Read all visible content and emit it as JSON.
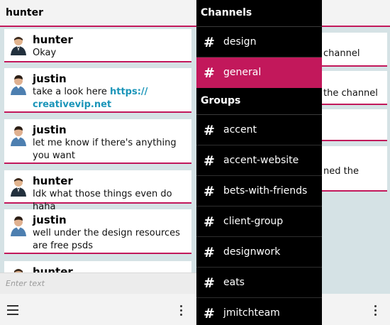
{
  "header": {
    "title": "hunter"
  },
  "messages": [
    {
      "name": "hunter",
      "text": "Okay",
      "avatar": "hunter-avatar"
    },
    {
      "name": "justin",
      "text": "take a look here ",
      "link": "https://\ncreativevip.net",
      "avatar": "justin-avatar"
    },
    {
      "name": "justin",
      "text": "let me know if there's anything you want",
      "avatar": "justin-avatar"
    },
    {
      "name": "hunter",
      "text": "Idk what those things even do haha",
      "avatar": "hunter-avatar"
    },
    {
      "name": "justin",
      "text": "well under the design resources are free psds",
      "avatar": "justin-avatar"
    },
    {
      "name": "hunter",
      "text": "",
      "avatar": "hunter-avatar"
    }
  ],
  "composer": {
    "placeholder": "Enter text"
  },
  "right_pane": {
    "snippets": [
      "channel",
      "the channel",
      "",
      "ned the"
    ]
  },
  "drawer": {
    "channels_heading": "Channels",
    "channels": [
      {
        "label": "design",
        "active": false
      },
      {
        "label": "general",
        "active": true
      }
    ],
    "groups_heading": "Groups",
    "groups": [
      {
        "label": "accent"
      },
      {
        "label": "accent-website"
      },
      {
        "label": "bets-with-friends"
      },
      {
        "label": "client-group"
      },
      {
        "label": "designwork"
      },
      {
        "label": "eats"
      },
      {
        "label": "jmitchteam"
      }
    ]
  },
  "icons": {
    "menu": "hamburger-icon",
    "overflow": "more-vertical-icon",
    "hash": "hash-icon"
  },
  "colors": {
    "accent": "#c2185b",
    "link": "#1b95b9",
    "drawer_bg": "#000000",
    "pane_bg": "#d5e2e5"
  }
}
